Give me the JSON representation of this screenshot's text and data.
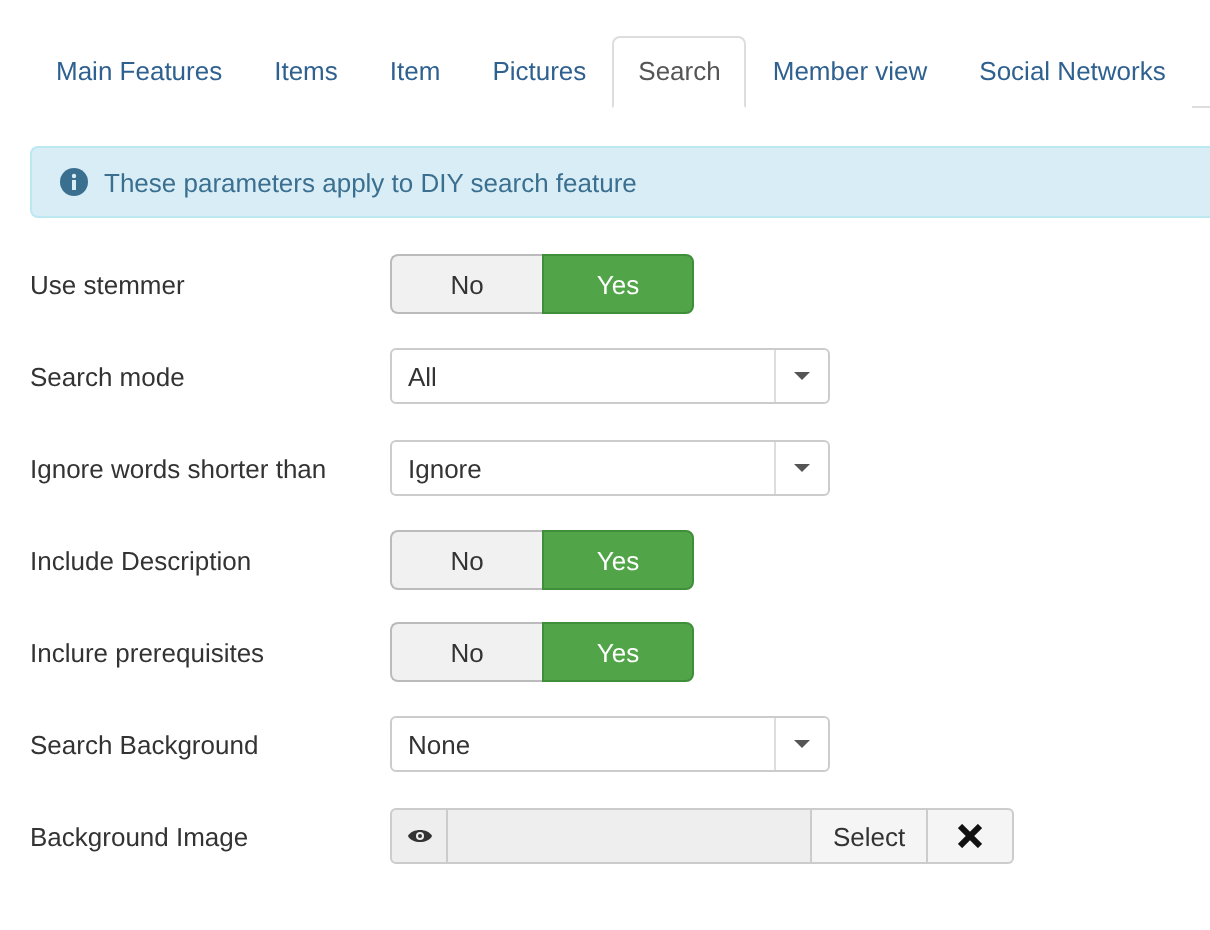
{
  "tabs": [
    {
      "label": "Main Features",
      "selected": false
    },
    {
      "label": "Items",
      "selected": false
    },
    {
      "label": "Item",
      "selected": false
    },
    {
      "label": "Pictures",
      "selected": false
    },
    {
      "label": "Search",
      "selected": true
    },
    {
      "label": "Member view",
      "selected": false
    },
    {
      "label": "Social Networks",
      "selected": false
    }
  ],
  "alert": {
    "text": "These parameters apply to DIY search feature"
  },
  "fields": [
    {
      "kind": "toggle",
      "label": "Use stemmer",
      "options": [
        {
          "label": "No",
          "selected": false
        },
        {
          "label": "Yes",
          "selected": true
        }
      ]
    },
    {
      "kind": "select",
      "label": "Search mode",
      "value": "All"
    },
    {
      "kind": "select",
      "label": "Ignore words shorter than",
      "value": "Ignore"
    },
    {
      "kind": "toggle",
      "label": "Include Description",
      "options": [
        {
          "label": "No",
          "selected": false
        },
        {
          "label": "Yes",
          "selected": true
        }
      ]
    },
    {
      "kind": "toggle",
      "label": "Inclure prerequisites",
      "options": [
        {
          "label": "No",
          "selected": false
        },
        {
          "label": "Yes",
          "selected": true
        }
      ]
    },
    {
      "kind": "select",
      "label": "Search Background",
      "value": "None"
    },
    {
      "kind": "media",
      "label": "Background Image",
      "button": "Select"
    }
  ]
}
